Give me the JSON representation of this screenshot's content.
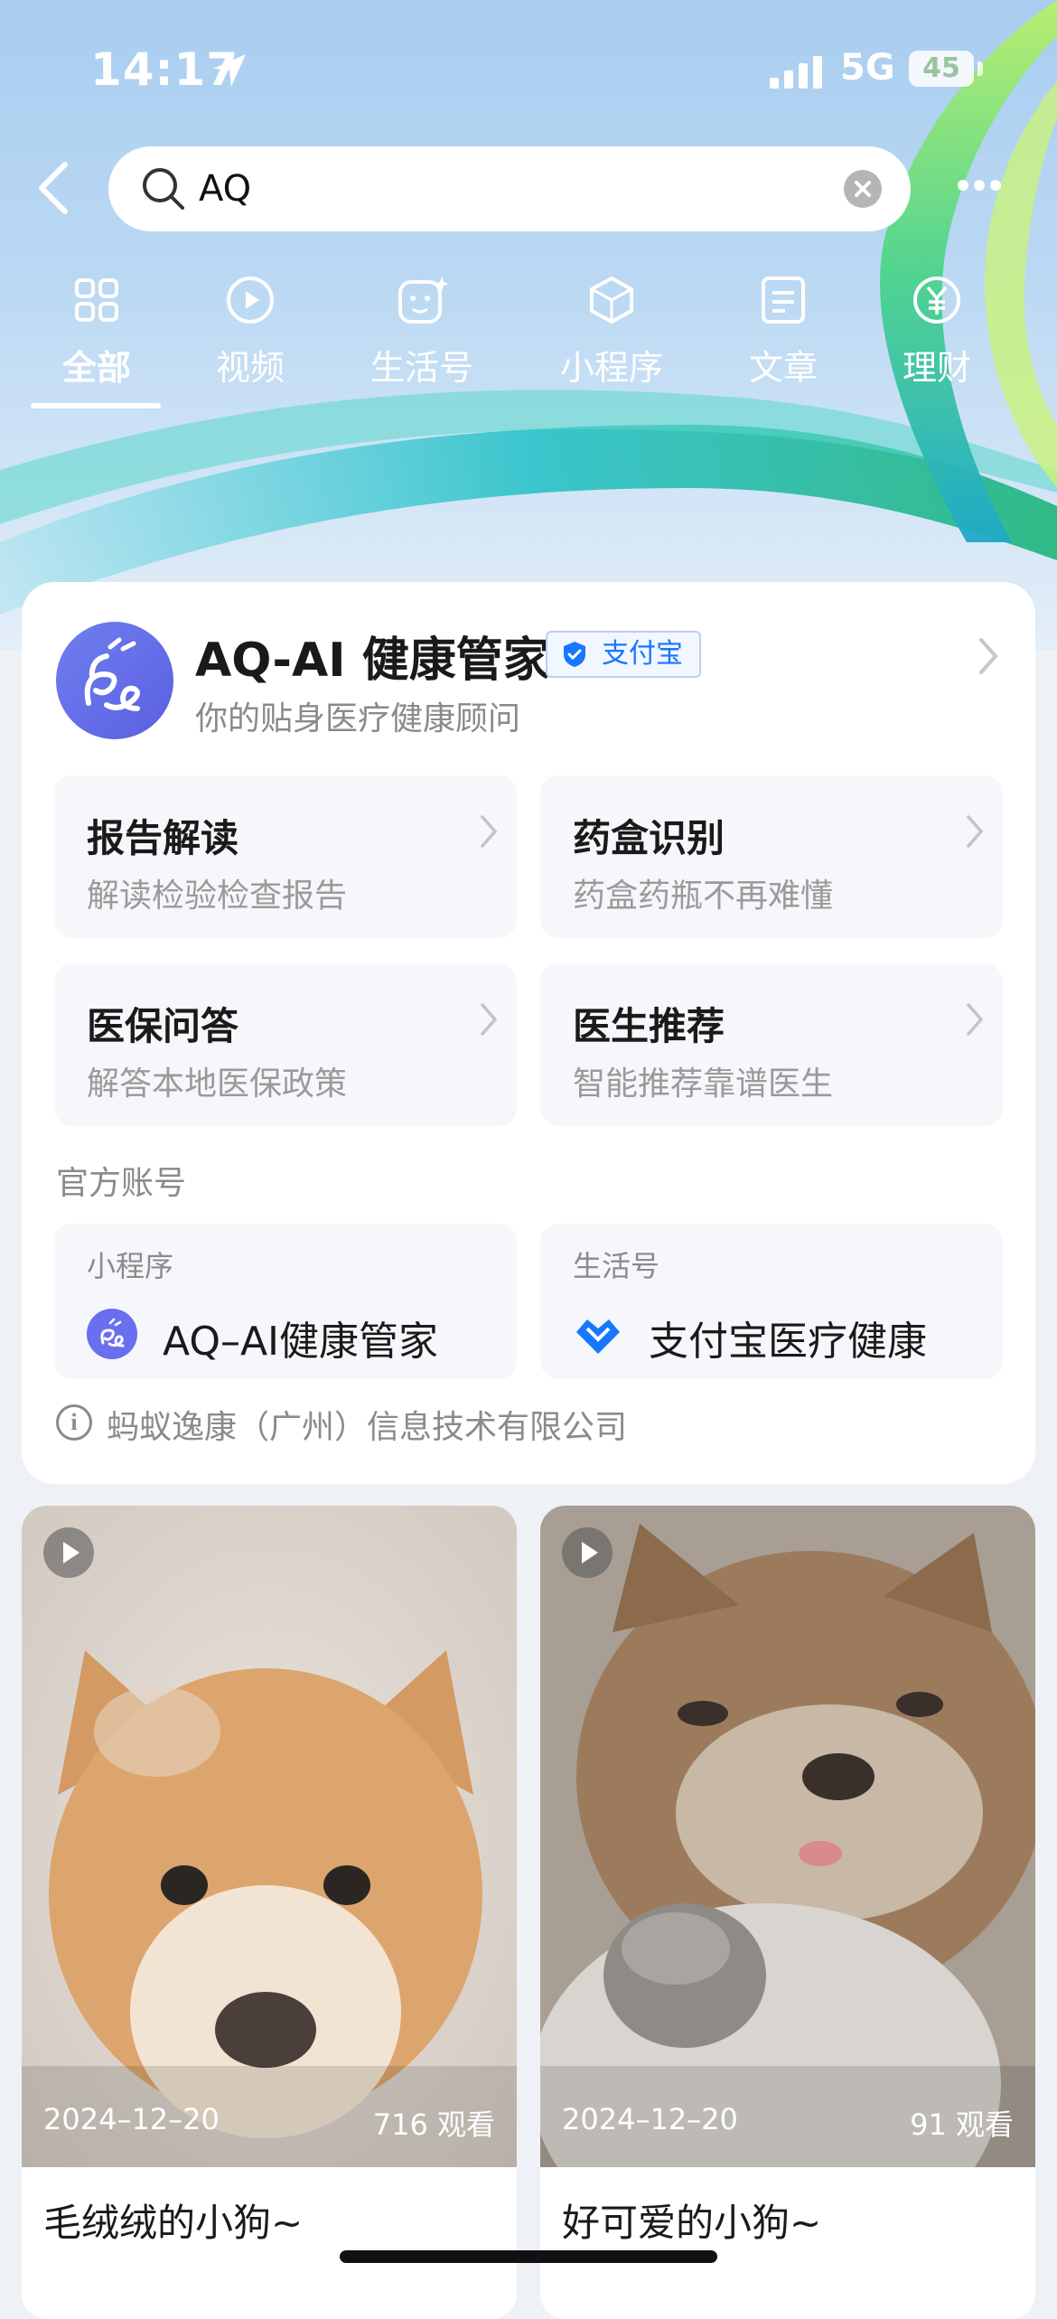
{
  "status_bar": {
    "time": "14:17",
    "network": "5G",
    "battery": "45"
  },
  "search": {
    "query": "AQ"
  },
  "tabs": [
    {
      "label": "全部",
      "icon": "grid-icon"
    },
    {
      "label": "视频",
      "icon": "play-circle-icon"
    },
    {
      "label": "生活号",
      "icon": "life-account-icon"
    },
    {
      "label": "小程序",
      "icon": "mini-program-icon"
    },
    {
      "label": "文章",
      "icon": "article-icon"
    },
    {
      "label": "理财",
      "icon": "yen-icon"
    }
  ],
  "result_card": {
    "title": "AQ-AI 健康管家",
    "badge": "支付宝",
    "subtitle": "你的贴身医疗健康顾问",
    "features": [
      {
        "title": "报告解读",
        "desc": "解读检验检查报告"
      },
      {
        "title": "药盒识别",
        "desc": "药盒药瓶不再难懂"
      },
      {
        "title": "医保问答",
        "desc": "解答本地医保政策"
      },
      {
        "title": "医生推荐",
        "desc": "智能推荐靠谱医生"
      }
    ],
    "official_label": "官方账号",
    "accounts": [
      {
        "type": "小程序",
        "name": "AQ–AI健康管家"
      },
      {
        "type": "生活号",
        "name": "支付宝医疗健康"
      }
    ],
    "company": "蚂蚁逸康（广州）信息技术有限公司"
  },
  "videos": [
    {
      "date": "2024–12–20",
      "views": "716 观看",
      "title": "毛绒绒的小狗~"
    },
    {
      "date": "2024–12–20",
      "views": "91 观看",
      "title": "好可爱的小狗~"
    }
  ]
}
